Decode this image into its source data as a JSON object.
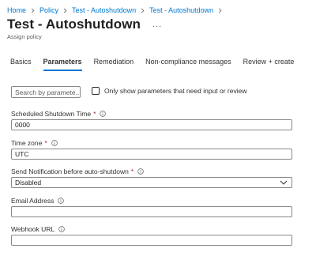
{
  "breadcrumb": {
    "items": [
      "Home",
      "Policy",
      "Test - Autoshutdown",
      "Test - Autoshutdown"
    ]
  },
  "header": {
    "title": "Test - Autoshutdown",
    "more": "...",
    "subtitle": "Assign policy"
  },
  "tabs": [
    {
      "label": "Basics",
      "active": false
    },
    {
      "label": "Parameters",
      "active": true
    },
    {
      "label": "Remediation",
      "active": false
    },
    {
      "label": "Non-compliance messages",
      "active": false
    },
    {
      "label": "Review + create",
      "active": false
    }
  ],
  "filter": {
    "search_placeholder": "Search by paramete...",
    "checkbox_label": "Only show parameters that need input or review",
    "checkbox_checked": false
  },
  "fields": {
    "shutdown_time": {
      "label": "Scheduled Shutdown Time",
      "required": "*",
      "value": "0000"
    },
    "time_zone": {
      "label": "Time zone",
      "required": "*",
      "value": "UTC"
    },
    "notification": {
      "label": "Send Notification before auto-shutdown",
      "required": "*",
      "value": "Disabled"
    },
    "email": {
      "label": "Email Address",
      "value": ""
    },
    "webhook": {
      "label": "Webhook URL",
      "value": ""
    }
  },
  "colors": {
    "accent": "#0078d4",
    "required": "#a4262c",
    "text": "#323130",
    "border": "#8a8886"
  },
  "icons": [
    "chevron-right-icon",
    "info-icon",
    "chevron-down-icon",
    "more-icon"
  ]
}
